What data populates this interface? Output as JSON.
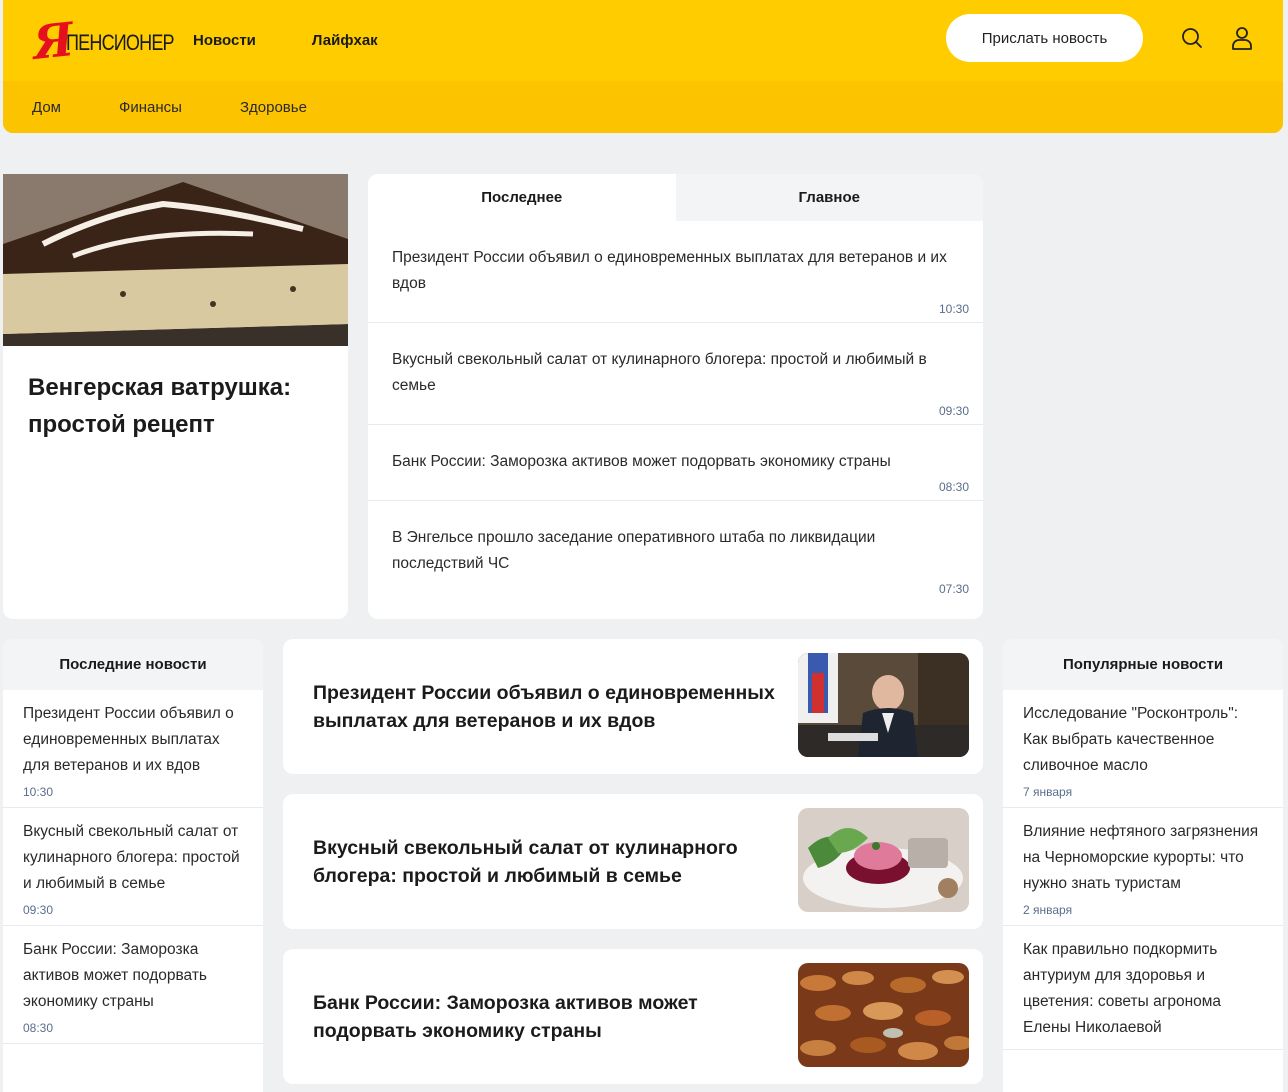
{
  "header": {
    "logo_ya": "Я",
    "logo_text": "пенсионер",
    "nav": [
      "Новости",
      "Лайфхак"
    ],
    "send_button": "Прислать новость",
    "sub_nav": [
      "Дом",
      "Финансы",
      "Здоровье"
    ],
    "colors": {
      "top": "#ffcc00",
      "bottom": "#fcc400",
      "logo_red": "#e5101d"
    }
  },
  "feature": {
    "title": "Венгерская ватрушка: простой рецепт",
    "image": "cheesecake-photo"
  },
  "tabs": {
    "labels": [
      "Последнее",
      "Главное"
    ],
    "active": 0,
    "items": [
      {
        "text": "Президент России объявил о единовременных выплатах для ветеранов и их вдов",
        "time": "10:30"
      },
      {
        "text": "Вкусный свекольный салат от кулинарного блогера: простой и любимый в семье",
        "time": "09:30"
      },
      {
        "text": "Банк России: Заморозка активов может подорвать экономику страны",
        "time": "08:30"
      },
      {
        "text": "В Энгельсе прошло заседание оперативного штаба по ликвидации последствий ЧС",
        "time": "07:30"
      }
    ]
  },
  "latest": {
    "title": "Последние новости",
    "items": [
      {
        "text": "Президент России объявил о единовременных выплатах для ветеранов и их вдов",
        "time": "10:30"
      },
      {
        "text": "Вкусный свекольный салат от кулинарного блогера: простой и любимый в семье",
        "time": "09:30"
      },
      {
        "text": "Банк России: Заморозка активов может подорвать экономику страны",
        "time": "08:30"
      }
    ]
  },
  "cards": [
    {
      "title": "Президент России объявил о единовременных выплатах для ветеранов и их вдов",
      "image": "president-photo"
    },
    {
      "title": "Вкусный свекольный салат от кулинарного блогера: простой и любимый в семье",
      "image": "beet-salad-photo"
    },
    {
      "title": "Банк России: Заморозка активов может подорвать экономику страны",
      "image": "coins-photo"
    }
  ],
  "popular": {
    "title": "Популярные новости",
    "items": [
      {
        "text": "Исследование \"Росконтроль\": Как выбрать качественное сливочное масло",
        "time": "7 января"
      },
      {
        "text": "Влияние нефтяного загрязнения на Черноморские курорты: что нужно знать туристам",
        "time": "2 января"
      },
      {
        "text": "Как правильно подкормить антуриум для здоровья и цветения: советы агронома Елены Николаевой",
        "time": ""
      }
    ]
  }
}
